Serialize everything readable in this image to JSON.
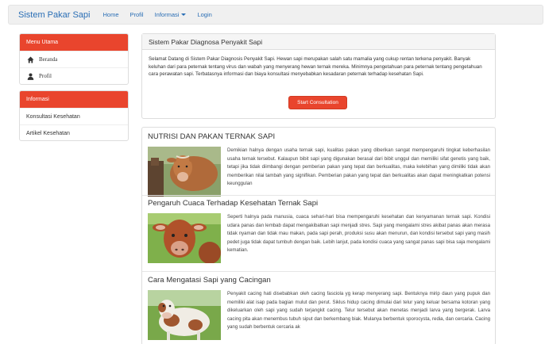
{
  "navbar": {
    "brand": "Sistem Pakar Sapi",
    "links": [
      "Home",
      "Profil",
      "Informasi",
      "Login"
    ]
  },
  "sidebar": {
    "menu_title": "Menu Utama",
    "menu_items": [
      {
        "label": "Beranda",
        "icon": "home-icon"
      },
      {
        "label": "Profil",
        "icon": "user-icon"
      }
    ],
    "info_title": "Informasi",
    "info_items": [
      "Konsultasi Kesehatan",
      "Artikel Kesehatan"
    ]
  },
  "main": {
    "title": "Sistem Pakar Diagnosa Penyakit Sapi",
    "welcome": "Selamat Datang di Sistem Pakar Diagnosis Penyakit Sapi. Hewan sapi merupakan salah satu mamalia yang cukup rentan terkena penyakit. Banyak keluhan dari para peternak tentang virus dan wabah yang menyerang hewan ternak mereka. Minimnya pengetahuan para peternak tentang pengetahuan cara perawatan sapi. Terbatasnya informasi dan biaya konsultasi menyebabkan kesadaran peternak terhadap kesehatan Sapi.",
    "button": "Start Consultation"
  },
  "articles": [
    {
      "title": "NUTRISI DAN PAKAN TERNAK SAPI",
      "text": "Demikian halnya dengan usaha ternak sapi, kualitas pakan yang diberikan sangat mempengaruhi tingkat keberhasilan usaha ternak tersebut. Kalaupun bibit sapi yang digunakan berasal dari bibit unggul dan memiliki sifat genetis yang baik, tetapi jika tidak diimbangi dengan pemberian pakan yang tepat dan berkualitas, maka kelebihan yang dimiliki tidak akan memberikan nilai tambah yang signifikan. Pemberian pakan yang tepat dan berkualitas akan dapat meningkatkan potensi keunggulan"
    },
    {
      "title": "Pengaruh Cuaca Terhadap Kesehatan Ternak Sapi",
      "text": "Seperti halnya pada manusia, cuaca sehari-hari bisa mempengaruhi kesehatan dan kenyamanan ternak sapi. Kondisi udara panas dan lembab dapat mengakibatkan sapi menjadi stres. Sapi yang mengalami stres akibat panas akan merasa tidak nyaman dan tidak mau makan, pada sapi perah, produksi susu akan menurun, dan kondisi tersebut sapi yang masih pedet juga tidak dapat tumbuh dengan baik. Lebih lanjut, pada kondisi cuaca yang sangat panas sapi bisa saja mengalami kematian."
    },
    {
      "title": "Cara Mengatasi Sapi yang Cacingan",
      "text": "Penyakit cacing hati disebabkan oleh cacing fasciola yg kerap menyerang sapi. Bentuknya mirip daun yang pupuk dan memiliki alat isap pada bagian mulut dan perut. Siklus hidup cacing dimulai dari telur yang keluar bersama kotoran yang dikeluarkan oleh sapi yang sudah terjangkit cacing. Telur tersebut akan menetas menjadi larva yang bergerak. Larva cacing pita akan menembus tubuh siput dan berkembang biak. Mulanya berbentuk sporocysta, redia, dan cercaria. Cacing yang sudah berbentuk cercaria ak"
    }
  ],
  "colors": {
    "accent": "#e9452d",
    "link": "#2a6eb5"
  }
}
